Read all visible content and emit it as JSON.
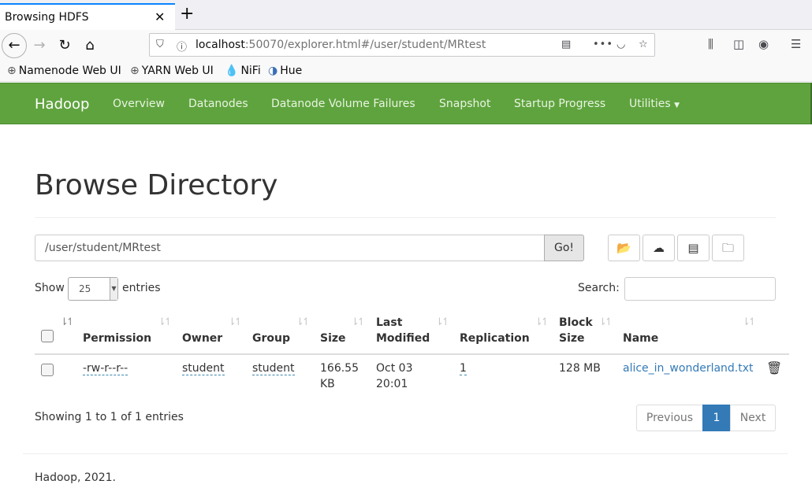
{
  "browser": {
    "tab_title": "Browsing HDFS",
    "url_host": "localhost",
    "url_rest": ":50070/explorer.html#/user/student/MRtest",
    "bookmarks": [
      "Namenode Web UI",
      "YARN Web UI",
      "NiFi",
      "Hue"
    ]
  },
  "navbar": {
    "brand": "Hadoop",
    "items": [
      "Overview",
      "Datanodes",
      "Datanode Volume Failures",
      "Snapshot",
      "Startup Progress",
      "Utilities"
    ]
  },
  "page": {
    "title": "Browse Directory",
    "path_value": "/user/student/MRtest",
    "go_label": "Go!",
    "show_label": "Show",
    "entries_value": "25",
    "entries_label": "entries",
    "search_label": "Search:"
  },
  "table": {
    "headers": {
      "permission": "Permission",
      "owner": "Owner",
      "group": "Group",
      "size": "Size",
      "last_modified_1": "Last",
      "last_modified_2": "Modified",
      "replication": "Replication",
      "block_size_1": "Block",
      "block_size_2": "Size",
      "name": "Name"
    },
    "rows": [
      {
        "permission": "-rw-r--r--",
        "owner": "student",
        "group": "student",
        "size_1": "166.55",
        "size_2": "KB",
        "modified_1": "Oct 03",
        "modified_2": "20:01",
        "replication": "1",
        "block_size": "128 MB",
        "name": "alice_in_wonderland.txt"
      }
    ]
  },
  "pagination": {
    "info": "Showing 1 to 1 of 1 entries",
    "previous": "Previous",
    "current": "1",
    "next": "Next"
  },
  "footer": "Hadoop, 2021."
}
